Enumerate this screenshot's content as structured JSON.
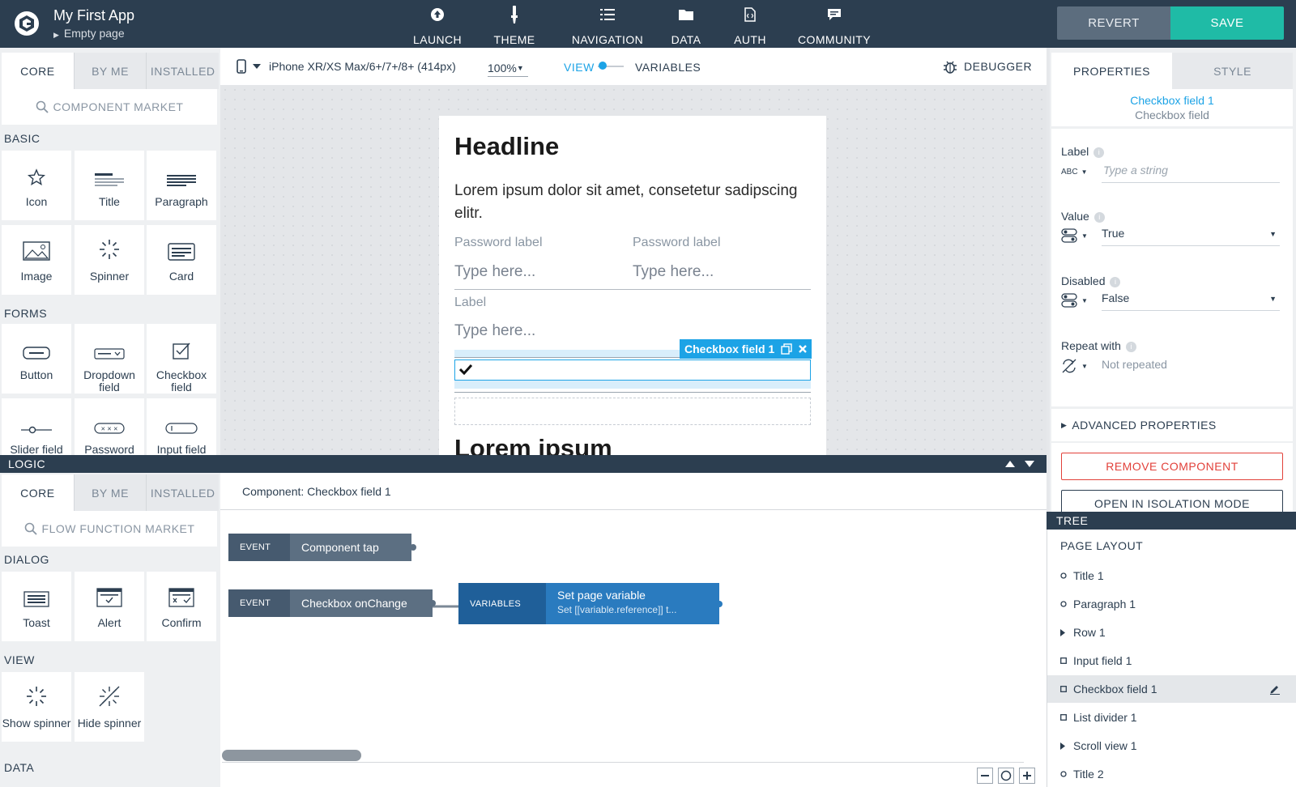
{
  "app": {
    "title": "My First App",
    "page": "Empty page"
  },
  "topnav": [
    {
      "label": "LAUNCH",
      "icon": "launch-icon"
    },
    {
      "label": "THEME",
      "icon": "theme-brush-icon"
    },
    {
      "label": "NAVIGATION",
      "icon": "navigation-list-icon"
    },
    {
      "label": "DATA",
      "icon": "folder-icon"
    },
    {
      "label": "AUTH",
      "icon": "auth-file-icon"
    },
    {
      "label": "COMMUNITY",
      "icon": "chat-icon"
    }
  ],
  "actions": {
    "revert": "REVERT",
    "save": "SAVE"
  },
  "colors": {
    "topbar": "#2c3e50",
    "accent": "#1fbba6",
    "selection": "#1ca3e6",
    "danger": "#e2413a",
    "node_var": "#2a7bbf"
  },
  "left": {
    "tabs": [
      "CORE",
      "BY ME",
      "INSTALLED"
    ],
    "search": "COMPONENT MARKET",
    "sections": {
      "basic": "BASIC",
      "forms": "FORMS"
    },
    "basic": [
      "Icon",
      "Title",
      "Paragraph",
      "Image",
      "Spinner",
      "Card"
    ],
    "forms": [
      "Button",
      "Dropdown field",
      "Checkbox field",
      "Slider field",
      "Password",
      "Input field"
    ]
  },
  "toolbar": {
    "device": "iPhone XR/XS Max/6+/7+/8+ (414px)",
    "zoom": "100%",
    "view": "VIEW",
    "variables": "VARIABLES",
    "debugger": "DEBUGGER"
  },
  "phone": {
    "headline": "Headline",
    "paragraph": "Lorem ipsum dolor sit amet, consetetur sadipscing elitr.",
    "pw_label_1": "Password label",
    "pw_label_2": "Password label",
    "pw_input_1": "Type here...",
    "pw_input_2": "Type here...",
    "label": "Label",
    "input": "Type here...",
    "selected_tag": "Checkbox field 1",
    "bottom_title": "Lorem ipsum"
  },
  "right": {
    "tabs": [
      "PROPERTIES",
      "STYLE"
    ],
    "component_name": "Checkbox field 1",
    "component_type": "Checkbox field",
    "label_title": "Label",
    "label_placeholder": "Type a string",
    "type_abc": "ABC",
    "value_title": "Value",
    "value_val": "True",
    "disabled_title": "Disabled",
    "disabled_val": "False",
    "repeat_title": "Repeat with",
    "repeat_val": "Not repeated",
    "advanced": "ADVANCED PROPERTIES",
    "remove": "REMOVE COMPONENT",
    "isolation": "OPEN IN ISOLATION MODE"
  },
  "logic": {
    "title": "LOGIC",
    "tabs": [
      "CORE",
      "BY ME",
      "INSTALLED"
    ],
    "search": "FLOW FUNCTION MARKET",
    "sections": {
      "dialog": "DIALOG",
      "view": "VIEW",
      "data": "DATA"
    },
    "dialog": [
      "Toast",
      "Alert",
      "Confirm"
    ],
    "view": [
      "Show spinner",
      "Hide spinner"
    ],
    "component_header": "Component: Checkbox field 1",
    "nodes": {
      "ev1_kind": "EVENT",
      "ev1_name": "Component tap",
      "ev2_kind": "EVENT",
      "ev2_name": "Checkbox onChange",
      "var_kind": "VARIABLES",
      "var_name": "Set page variable",
      "var_sub": "Set [[variable.reference]] t..."
    }
  },
  "tree": {
    "title": "TREE",
    "section": "PAGE LAYOUT",
    "items": [
      {
        "label": "Title 1",
        "bullet": "circle"
      },
      {
        "label": "Paragraph 1",
        "bullet": "circle"
      },
      {
        "label": "Row 1",
        "bullet": "triangle"
      },
      {
        "label": "Input field 1",
        "bullet": "square"
      },
      {
        "label": "Checkbox field 1",
        "bullet": "square",
        "selected": true
      },
      {
        "label": "List divider 1",
        "bullet": "square"
      },
      {
        "label": "Scroll view 1",
        "bullet": "triangle"
      },
      {
        "label": "Title 2",
        "bullet": "circle"
      }
    ]
  }
}
